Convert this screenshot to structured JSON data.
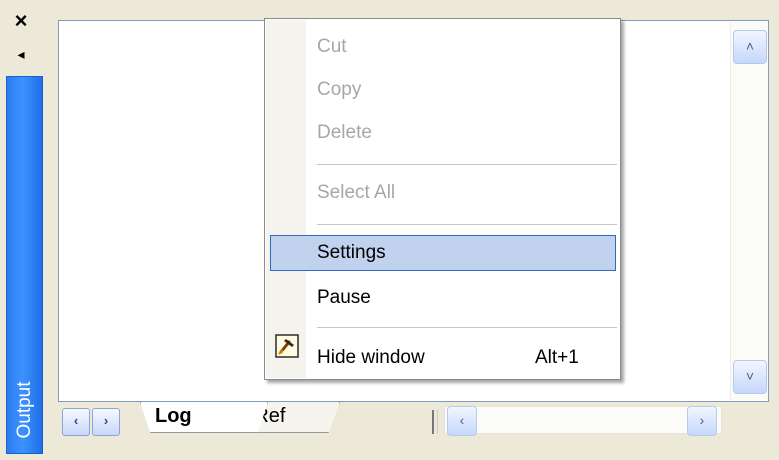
{
  "panel": {
    "close_glyph": "×",
    "pin_glyph": "◂",
    "side_tab_label": "Output"
  },
  "tabs": [
    {
      "label": "Log",
      "active": true
    },
    {
      "label": "XRef",
      "active": false
    }
  ],
  "nav": {
    "prev_glyph": "‹",
    "next_glyph": "›"
  },
  "scroll": {
    "up_glyph": "˄",
    "down_glyph": "˅",
    "left_glyph": "‹",
    "right_glyph": "›"
  },
  "context_menu": {
    "cut": {
      "label": "Cut",
      "enabled": false
    },
    "copy": {
      "label": "Copy",
      "enabled": false
    },
    "delete": {
      "label": "Delete",
      "enabled": false
    },
    "select_all": {
      "label": "Select All",
      "enabled": false
    },
    "settings": {
      "label": "Settings",
      "highlighted": true
    },
    "pause": {
      "label": "Pause"
    },
    "hide_window": {
      "label": "Hide window",
      "shortcut": "Alt+1",
      "icon": "pin-hammer-icon"
    }
  },
  "colors": {
    "side_tab": "#3d92ff",
    "highlight": "#c1d2ee",
    "highlight_border": "#316ac5",
    "disabled_text": "#a7a6aa"
  }
}
